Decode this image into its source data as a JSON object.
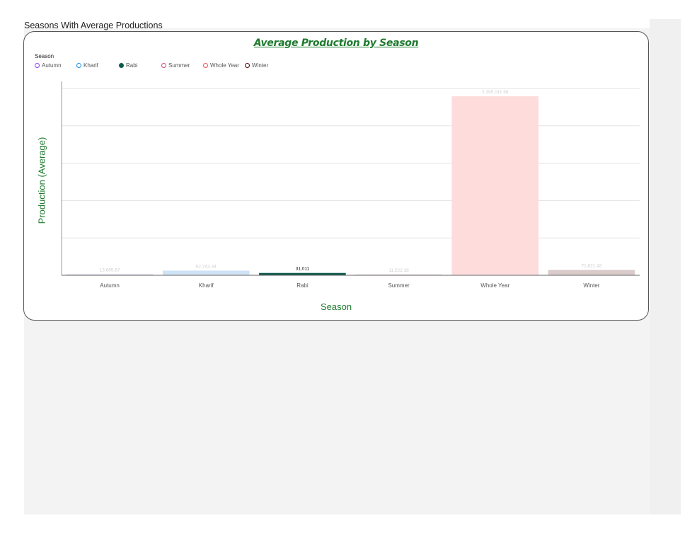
{
  "page": {
    "section_title": "Seasons With Average Productions"
  },
  "colors": {
    "accent_green": "#1e7a2e",
    "axis": "#999999",
    "grid": "#e3e3e3"
  },
  "chart_data": {
    "type": "bar",
    "title": "Average Production by Season ",
    "xlabel": "Season",
    "ylabel": "Production (Average)",
    "legend_title": "Season",
    "legend_position": "top-left",
    "grid": true,
    "ylim": [
      0,
      2500000
    ],
    "categories": [
      "Autumn",
      "Kharif",
      "Rabi",
      "Summer",
      "Whole Year",
      "Winter"
    ],
    "values": [
      13665.67,
      62743.34,
      31011,
      11522.38,
      2395011.98,
      71821.42
    ],
    "value_labels": [
      "13,665.67",
      "62,743.34",
      "31,011",
      "11,522.38",
      "2,395,011.98",
      "71,821.42"
    ],
    "bar_colors": [
      "#d9d0ea",
      "#cfe3f5",
      "#0d5a4c",
      "#e7d3da",
      "#fedcdc",
      "#dacbcb"
    ],
    "legend_fills": [
      "#ffffff",
      "#ffffff",
      "#0d5a4c",
      "#ffffff",
      "#ffffff",
      "#ffffff"
    ],
    "legend_strokes": [
      "#8a3ffc",
      "#1192e8",
      "#0d5a4c",
      "#d4447a",
      "#fa4d56",
      "#570408"
    ],
    "highlighted": "Rabi"
  }
}
